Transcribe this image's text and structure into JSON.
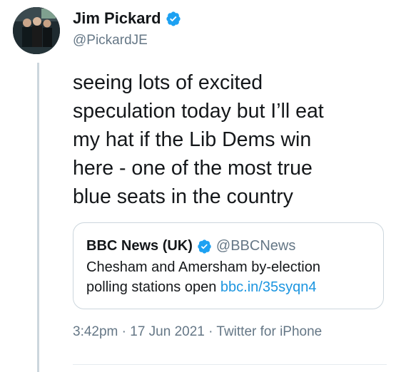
{
  "tweet": {
    "author": {
      "display_name": "Jim Pickard",
      "handle": "@PickardJE",
      "verified": true,
      "avatar_icon": "profile-photo"
    },
    "text": "seeing lots of excited\nspeculation today but I’ll eat\nmy hat if the Lib Dems win\nhere - one of the most true\nblue seats in the country",
    "quoted_tweet": {
      "display_name": "BBC News (UK)",
      "handle": "@BBCNews",
      "verified": true,
      "text_line1": "Chesham and Amersham by-election",
      "text_line2": "polling stations open ",
      "link_text": "bbc.in/35syqn4"
    },
    "time": "3:42pm",
    "date": "17 Jun 2021",
    "source": "Twitter for iPhone",
    "separator": "·"
  },
  "colors": {
    "verified_blue": "#1da1f2",
    "link_blue": "#1b95e0",
    "secondary_text": "#657786",
    "border": "#ccd6dd"
  }
}
